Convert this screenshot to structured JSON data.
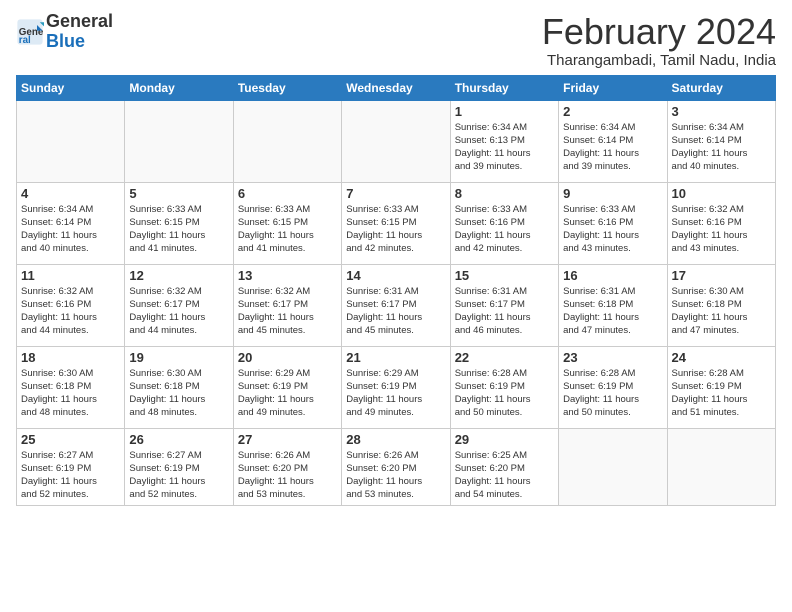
{
  "logo": {
    "general": "General",
    "blue": "Blue"
  },
  "header": {
    "title": "February 2024",
    "subtitle": "Tharangambadi, Tamil Nadu, India"
  },
  "weekdays": [
    "Sunday",
    "Monday",
    "Tuesday",
    "Wednesday",
    "Thursday",
    "Friday",
    "Saturday"
  ],
  "weeks": [
    [
      {
        "day": "",
        "info": ""
      },
      {
        "day": "",
        "info": ""
      },
      {
        "day": "",
        "info": ""
      },
      {
        "day": "",
        "info": ""
      },
      {
        "day": "1",
        "info": "Sunrise: 6:34 AM\nSunset: 6:13 PM\nDaylight: 11 hours\nand 39 minutes."
      },
      {
        "day": "2",
        "info": "Sunrise: 6:34 AM\nSunset: 6:14 PM\nDaylight: 11 hours\nand 39 minutes."
      },
      {
        "day": "3",
        "info": "Sunrise: 6:34 AM\nSunset: 6:14 PM\nDaylight: 11 hours\nand 40 minutes."
      }
    ],
    [
      {
        "day": "4",
        "info": "Sunrise: 6:34 AM\nSunset: 6:14 PM\nDaylight: 11 hours\nand 40 minutes."
      },
      {
        "day": "5",
        "info": "Sunrise: 6:33 AM\nSunset: 6:15 PM\nDaylight: 11 hours\nand 41 minutes."
      },
      {
        "day": "6",
        "info": "Sunrise: 6:33 AM\nSunset: 6:15 PM\nDaylight: 11 hours\nand 41 minutes."
      },
      {
        "day": "7",
        "info": "Sunrise: 6:33 AM\nSunset: 6:15 PM\nDaylight: 11 hours\nand 42 minutes."
      },
      {
        "day": "8",
        "info": "Sunrise: 6:33 AM\nSunset: 6:16 PM\nDaylight: 11 hours\nand 42 minutes."
      },
      {
        "day": "9",
        "info": "Sunrise: 6:33 AM\nSunset: 6:16 PM\nDaylight: 11 hours\nand 43 minutes."
      },
      {
        "day": "10",
        "info": "Sunrise: 6:32 AM\nSunset: 6:16 PM\nDaylight: 11 hours\nand 43 minutes."
      }
    ],
    [
      {
        "day": "11",
        "info": "Sunrise: 6:32 AM\nSunset: 6:16 PM\nDaylight: 11 hours\nand 44 minutes."
      },
      {
        "day": "12",
        "info": "Sunrise: 6:32 AM\nSunset: 6:17 PM\nDaylight: 11 hours\nand 44 minutes."
      },
      {
        "day": "13",
        "info": "Sunrise: 6:32 AM\nSunset: 6:17 PM\nDaylight: 11 hours\nand 45 minutes."
      },
      {
        "day": "14",
        "info": "Sunrise: 6:31 AM\nSunset: 6:17 PM\nDaylight: 11 hours\nand 45 minutes."
      },
      {
        "day": "15",
        "info": "Sunrise: 6:31 AM\nSunset: 6:17 PM\nDaylight: 11 hours\nand 46 minutes."
      },
      {
        "day": "16",
        "info": "Sunrise: 6:31 AM\nSunset: 6:18 PM\nDaylight: 11 hours\nand 47 minutes."
      },
      {
        "day": "17",
        "info": "Sunrise: 6:30 AM\nSunset: 6:18 PM\nDaylight: 11 hours\nand 47 minutes."
      }
    ],
    [
      {
        "day": "18",
        "info": "Sunrise: 6:30 AM\nSunset: 6:18 PM\nDaylight: 11 hours\nand 48 minutes."
      },
      {
        "day": "19",
        "info": "Sunrise: 6:30 AM\nSunset: 6:18 PM\nDaylight: 11 hours\nand 48 minutes."
      },
      {
        "day": "20",
        "info": "Sunrise: 6:29 AM\nSunset: 6:19 PM\nDaylight: 11 hours\nand 49 minutes."
      },
      {
        "day": "21",
        "info": "Sunrise: 6:29 AM\nSunset: 6:19 PM\nDaylight: 11 hours\nand 49 minutes."
      },
      {
        "day": "22",
        "info": "Sunrise: 6:28 AM\nSunset: 6:19 PM\nDaylight: 11 hours\nand 50 minutes."
      },
      {
        "day": "23",
        "info": "Sunrise: 6:28 AM\nSunset: 6:19 PM\nDaylight: 11 hours\nand 50 minutes."
      },
      {
        "day": "24",
        "info": "Sunrise: 6:28 AM\nSunset: 6:19 PM\nDaylight: 11 hours\nand 51 minutes."
      }
    ],
    [
      {
        "day": "25",
        "info": "Sunrise: 6:27 AM\nSunset: 6:19 PM\nDaylight: 11 hours\nand 52 minutes."
      },
      {
        "day": "26",
        "info": "Sunrise: 6:27 AM\nSunset: 6:19 PM\nDaylight: 11 hours\nand 52 minutes."
      },
      {
        "day": "27",
        "info": "Sunrise: 6:26 AM\nSunset: 6:20 PM\nDaylight: 11 hours\nand 53 minutes."
      },
      {
        "day": "28",
        "info": "Sunrise: 6:26 AM\nSunset: 6:20 PM\nDaylight: 11 hours\nand 53 minutes."
      },
      {
        "day": "29",
        "info": "Sunrise: 6:25 AM\nSunset: 6:20 PM\nDaylight: 11 hours\nand 54 minutes."
      },
      {
        "day": "",
        "info": ""
      },
      {
        "day": "",
        "info": ""
      }
    ]
  ]
}
